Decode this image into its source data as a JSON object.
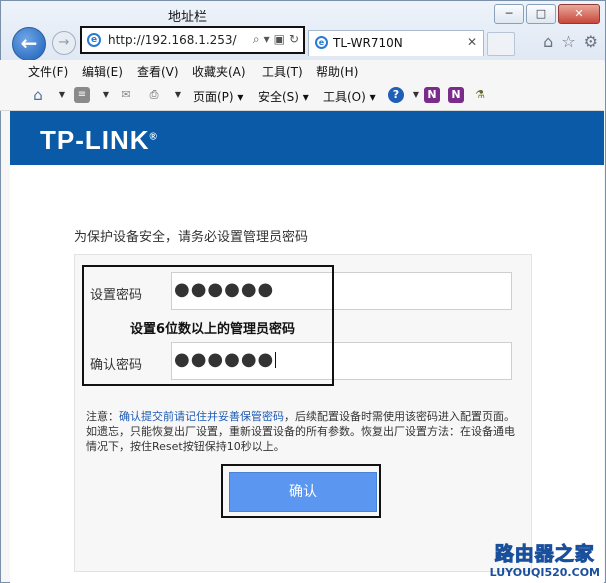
{
  "annotations": {
    "address_bar_label": "地址栏"
  },
  "window": {
    "controls": {
      "minimize": "─",
      "maximize": "□",
      "close": "✕"
    }
  },
  "browser": {
    "address": "http://192.168.1.253/",
    "address_icons": [
      "⌕",
      "▾",
      "▣",
      "↻"
    ],
    "tab_title": "TL-WR710N",
    "tab_close": "✕",
    "right_icons": [
      "⌂",
      "☆",
      "⚙"
    ]
  },
  "menubar": {
    "items": [
      "文件(F)",
      "编辑(E)",
      "查看(V)",
      "收藏夹(A)",
      "工具(T)",
      "帮助(H)"
    ]
  },
  "commandbar": {
    "page": "页面(P)",
    "safety": "安全(S)",
    "tools": "工具(O)"
  },
  "brand": {
    "logo": "TP-LINK",
    "logo_mark": "®"
  },
  "form": {
    "notice": "为保护设备安全，请务必设置管理员密码",
    "password_label": "设置密码",
    "password_value": "●●●●●●",
    "confirm_label": "确认密码",
    "confirm_value": "●●●●●●",
    "hint": "设置6位数以上的管理员密码",
    "note_prefix": "注意：",
    "note_link": "确认提交前请记住并妥善保管密码",
    "note_rest": "，后续配置设备时需使用该密码进入配置页面。如遗忘，只能恢复出厂设置，重新设置设备的所有参数。恢复出厂设置方法：在设备通电情况下，按住Reset按钮保持10秒以上。",
    "confirm_button": "确认"
  },
  "watermark": {
    "cn": "路由器之家",
    "en": "LUYOUQI520.COM"
  }
}
